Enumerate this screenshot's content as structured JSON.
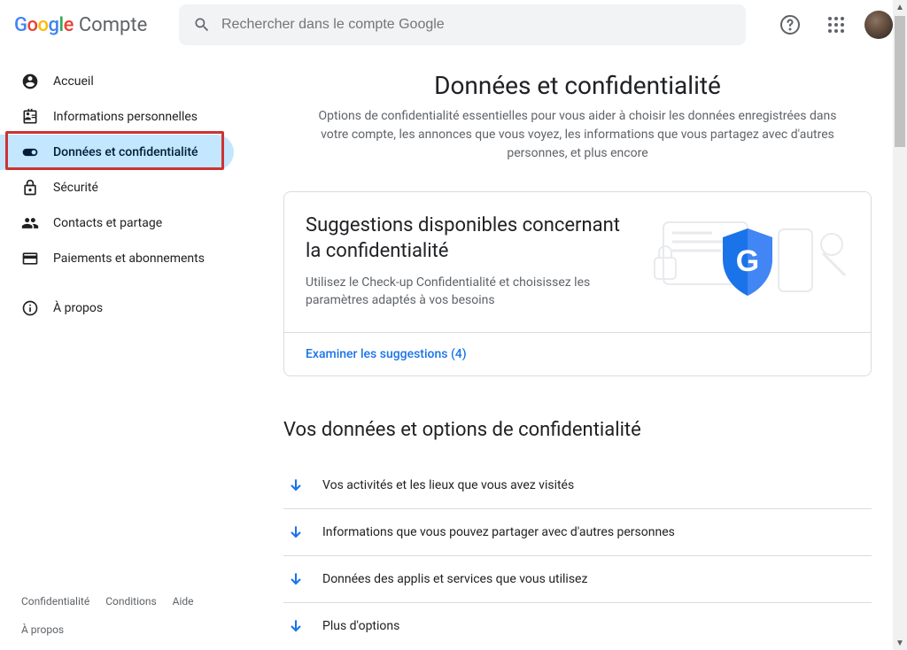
{
  "header": {
    "logo_text": "Compte",
    "search_placeholder": "Rechercher dans le compte Google"
  },
  "sidebar": {
    "items": [
      {
        "label": "Accueil",
        "icon": "home"
      },
      {
        "label": "Informations personnelles",
        "icon": "badge"
      },
      {
        "label": "Données et confidentialité",
        "icon": "toggle",
        "active": true
      },
      {
        "label": "Sécurité",
        "icon": "lock"
      },
      {
        "label": "Contacts et partage",
        "icon": "people"
      },
      {
        "label": "Paiements et abonnements",
        "icon": "card"
      },
      {
        "label": "À propos",
        "icon": "info"
      }
    ],
    "footer": {
      "privacy": "Confidentialité",
      "terms": "Conditions",
      "help": "Aide",
      "about": "À propos"
    }
  },
  "main": {
    "title": "Données et confidentialité",
    "subtitle": "Options de confidentialité essentielles pour vous aider à choisir les données enregistrées dans votre compte, les annonces que vous voyez, les informations que vous partagez avec d'autres personnes, et plus encore",
    "suggestion_card": {
      "title": "Suggestions disponibles concernant la confidentialité",
      "desc": "Utilisez le Check-up Confidentialité et choisissez les paramètres adaptés à vos besoins",
      "link": "Examiner les suggestions (4)"
    },
    "section2_title": "Vos données et options de confidentialité",
    "options": [
      "Vos activités et les lieux que vous avez visités",
      "Informations que vous pouvez partager avec d'autres personnes",
      "Données des applis et services que vous utilisez",
      "Plus d'options"
    ]
  }
}
